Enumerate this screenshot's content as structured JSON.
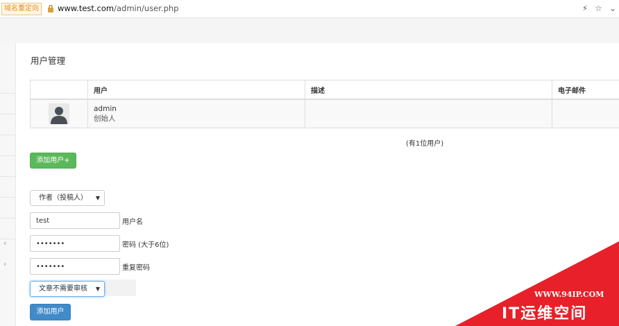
{
  "browser": {
    "redirect_badge": "域名重定向",
    "url_domain": "www.test.com",
    "url_path": "/admin/user.php",
    "icons": [
      "bolt-icon",
      "star-icon",
      "chevron-down-icon"
    ]
  },
  "page": {
    "title": "用户管理"
  },
  "users_table": {
    "columns": [
      "",
      "用户",
      "描述",
      "电子邮件"
    ],
    "rows": [
      {
        "username": "admin",
        "role": "创始人",
        "description": "",
        "email": ""
      }
    ],
    "count_text": "(有1位用户)"
  },
  "add_user_toggle": {
    "label": "添加用户+",
    "color": "#5cb85c"
  },
  "form": {
    "role_select": "作者（投稿人）",
    "username_value": "test",
    "username_label": "用户名",
    "password_value": "•••••••",
    "password_label": "密码 (大于6位)",
    "password_confirm_value": "•••••••",
    "password_confirm_label": "重复密码",
    "review_select": "文章不需要审核",
    "submit_label": "添加用户",
    "submit_color": "#428bca"
  },
  "watermark": {
    "url": "WWW.94IP.COM",
    "brand": "IT运维空间",
    "color": "#e8202a"
  }
}
